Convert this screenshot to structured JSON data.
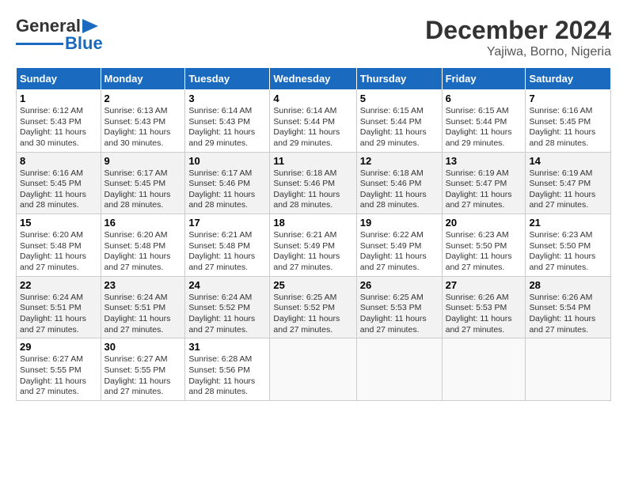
{
  "logo": {
    "line1": "General",
    "line2": "Blue"
  },
  "title": "December 2024",
  "subtitle": "Yajiwa, Borno, Nigeria",
  "days_of_week": [
    "Sunday",
    "Monday",
    "Tuesday",
    "Wednesday",
    "Thursday",
    "Friday",
    "Saturday"
  ],
  "weeks": [
    [
      {
        "day": "1",
        "text": "Sunrise: 6:12 AM\nSunset: 5:43 PM\nDaylight: 11 hours\nand 30 minutes."
      },
      {
        "day": "2",
        "text": "Sunrise: 6:13 AM\nSunset: 5:43 PM\nDaylight: 11 hours\nand 30 minutes."
      },
      {
        "day": "3",
        "text": "Sunrise: 6:14 AM\nSunset: 5:43 PM\nDaylight: 11 hours\nand 29 minutes."
      },
      {
        "day": "4",
        "text": "Sunrise: 6:14 AM\nSunset: 5:44 PM\nDaylight: 11 hours\nand 29 minutes."
      },
      {
        "day": "5",
        "text": "Sunrise: 6:15 AM\nSunset: 5:44 PM\nDaylight: 11 hours\nand 29 minutes."
      },
      {
        "day": "6",
        "text": "Sunrise: 6:15 AM\nSunset: 5:44 PM\nDaylight: 11 hours\nand 29 minutes."
      },
      {
        "day": "7",
        "text": "Sunrise: 6:16 AM\nSunset: 5:45 PM\nDaylight: 11 hours\nand 28 minutes."
      }
    ],
    [
      {
        "day": "8",
        "text": "Sunrise: 6:16 AM\nSunset: 5:45 PM\nDaylight: 11 hours\nand 28 minutes."
      },
      {
        "day": "9",
        "text": "Sunrise: 6:17 AM\nSunset: 5:45 PM\nDaylight: 11 hours\nand 28 minutes."
      },
      {
        "day": "10",
        "text": "Sunrise: 6:17 AM\nSunset: 5:46 PM\nDaylight: 11 hours\nand 28 minutes."
      },
      {
        "day": "11",
        "text": "Sunrise: 6:18 AM\nSunset: 5:46 PM\nDaylight: 11 hours\nand 28 minutes."
      },
      {
        "day": "12",
        "text": "Sunrise: 6:18 AM\nSunset: 5:46 PM\nDaylight: 11 hours\nand 28 minutes."
      },
      {
        "day": "13",
        "text": "Sunrise: 6:19 AM\nSunset: 5:47 PM\nDaylight: 11 hours\nand 27 minutes."
      },
      {
        "day": "14",
        "text": "Sunrise: 6:19 AM\nSunset: 5:47 PM\nDaylight: 11 hours\nand 27 minutes."
      }
    ],
    [
      {
        "day": "15",
        "text": "Sunrise: 6:20 AM\nSunset: 5:48 PM\nDaylight: 11 hours\nand 27 minutes."
      },
      {
        "day": "16",
        "text": "Sunrise: 6:20 AM\nSunset: 5:48 PM\nDaylight: 11 hours\nand 27 minutes."
      },
      {
        "day": "17",
        "text": "Sunrise: 6:21 AM\nSunset: 5:48 PM\nDaylight: 11 hours\nand 27 minutes."
      },
      {
        "day": "18",
        "text": "Sunrise: 6:21 AM\nSunset: 5:49 PM\nDaylight: 11 hours\nand 27 minutes."
      },
      {
        "day": "19",
        "text": "Sunrise: 6:22 AM\nSunset: 5:49 PM\nDaylight: 11 hours\nand 27 minutes."
      },
      {
        "day": "20",
        "text": "Sunrise: 6:23 AM\nSunset: 5:50 PM\nDaylight: 11 hours\nand 27 minutes."
      },
      {
        "day": "21",
        "text": "Sunrise: 6:23 AM\nSunset: 5:50 PM\nDaylight: 11 hours\nand 27 minutes."
      }
    ],
    [
      {
        "day": "22",
        "text": "Sunrise: 6:24 AM\nSunset: 5:51 PM\nDaylight: 11 hours\nand 27 minutes."
      },
      {
        "day": "23",
        "text": "Sunrise: 6:24 AM\nSunset: 5:51 PM\nDaylight: 11 hours\nand 27 minutes."
      },
      {
        "day": "24",
        "text": "Sunrise: 6:24 AM\nSunset: 5:52 PM\nDaylight: 11 hours\nand 27 minutes."
      },
      {
        "day": "25",
        "text": "Sunrise: 6:25 AM\nSunset: 5:52 PM\nDaylight: 11 hours\nand 27 minutes."
      },
      {
        "day": "26",
        "text": "Sunrise: 6:25 AM\nSunset: 5:53 PM\nDaylight: 11 hours\nand 27 minutes."
      },
      {
        "day": "27",
        "text": "Sunrise: 6:26 AM\nSunset: 5:53 PM\nDaylight: 11 hours\nand 27 minutes."
      },
      {
        "day": "28",
        "text": "Sunrise: 6:26 AM\nSunset: 5:54 PM\nDaylight: 11 hours\nand 27 minutes."
      }
    ],
    [
      {
        "day": "29",
        "text": "Sunrise: 6:27 AM\nSunset: 5:55 PM\nDaylight: 11 hours\nand 27 minutes."
      },
      {
        "day": "30",
        "text": "Sunrise: 6:27 AM\nSunset: 5:55 PM\nDaylight: 11 hours\nand 27 minutes."
      },
      {
        "day": "31",
        "text": "Sunrise: 6:28 AM\nSunset: 5:56 PM\nDaylight: 11 hours\nand 28 minutes."
      },
      {
        "day": "",
        "text": ""
      },
      {
        "day": "",
        "text": ""
      },
      {
        "day": "",
        "text": ""
      },
      {
        "day": "",
        "text": ""
      }
    ]
  ]
}
